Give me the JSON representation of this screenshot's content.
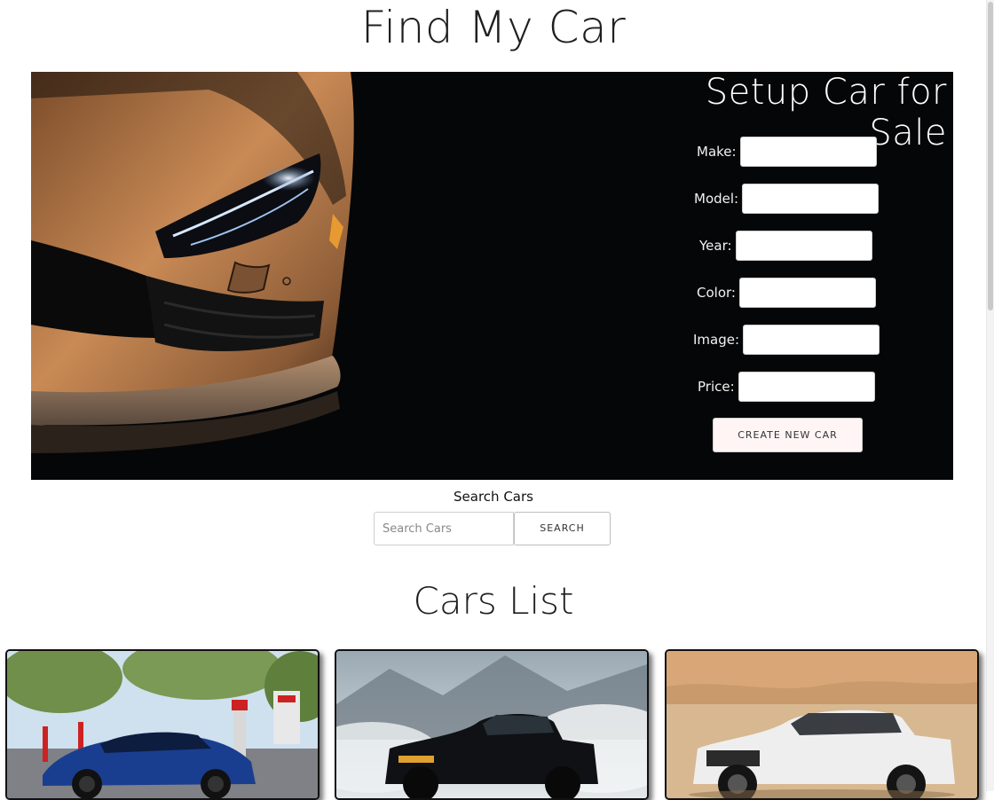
{
  "header": {
    "title": "Find My Car"
  },
  "form": {
    "title": "Setup Car for Sale",
    "fields": [
      {
        "label": "Make:",
        "value": ""
      },
      {
        "label": "Model:",
        "value": ""
      },
      {
        "label": "Year:",
        "value": ""
      },
      {
        "label": "Color:",
        "value": ""
      },
      {
        "label": "Image:",
        "value": ""
      },
      {
        "label": "Price:",
        "value": ""
      }
    ],
    "submit_label": "CREATE NEW CAR"
  },
  "search": {
    "label": "Search Cars",
    "placeholder": "Search Cars",
    "value": "",
    "button_label": "SEARCH"
  },
  "cars_list": {
    "title": "Cars List",
    "cars": [
      {
        "image": "blue-sedan-at-charging-station"
      },
      {
        "image": "black-pickup-truck-in-mist"
      },
      {
        "image": "white-pickup-truck-in-desert"
      }
    ]
  },
  "colors": {
    "hero_background": "#050607",
    "button_background": "#fff5f5"
  }
}
